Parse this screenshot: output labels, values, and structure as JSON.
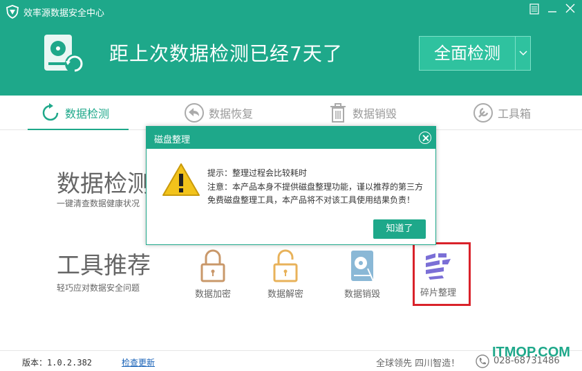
{
  "app": {
    "title": "效率源数据安全中心"
  },
  "header": {
    "message": "距上次数据检测已经7天了",
    "scan_button": "全面检测"
  },
  "tabs": [
    {
      "label": "数据检测",
      "icon": "refresh-icon",
      "active": true
    },
    {
      "label": "数据恢复",
      "icon": "back-arrow-icon",
      "active": false
    },
    {
      "label": "数据销毁",
      "icon": "trash-icon",
      "active": false
    },
    {
      "label": "工具箱",
      "icon": "wrench-icon",
      "active": false
    }
  ],
  "detect": {
    "title": "数据检测",
    "subtitle": "一键清查数据健康状况"
  },
  "tools": {
    "title": "工具推荐",
    "subtitle": "轻巧应对数据安全问题",
    "items": [
      {
        "label": "数据加密",
        "icon": "lock-icon"
      },
      {
        "label": "数据解密",
        "icon": "unlock-icon"
      },
      {
        "label": "数据销毁",
        "icon": "disk-shred-icon"
      },
      {
        "label": "碎片整理",
        "icon": "defrag-icon"
      }
    ]
  },
  "dialog": {
    "title": "磁盘整理",
    "line1": "提示：整理过程会比较耗时",
    "line2": "注意：本产品本身不提供磁盘整理功能，谨以推荐的第三方免费磁盘整理工具，本产品将不对该工具使用结果负责！",
    "ok": "知道了"
  },
  "footer": {
    "version": "版本：1.0.2.382",
    "update": "检查更新",
    "slogan": "全球领先 四川智造！",
    "phone": "028-68731486"
  },
  "watermark": "ITMOP.COM",
  "colors": {
    "brand": "#1ea88a",
    "highlight": "#d9222a"
  }
}
